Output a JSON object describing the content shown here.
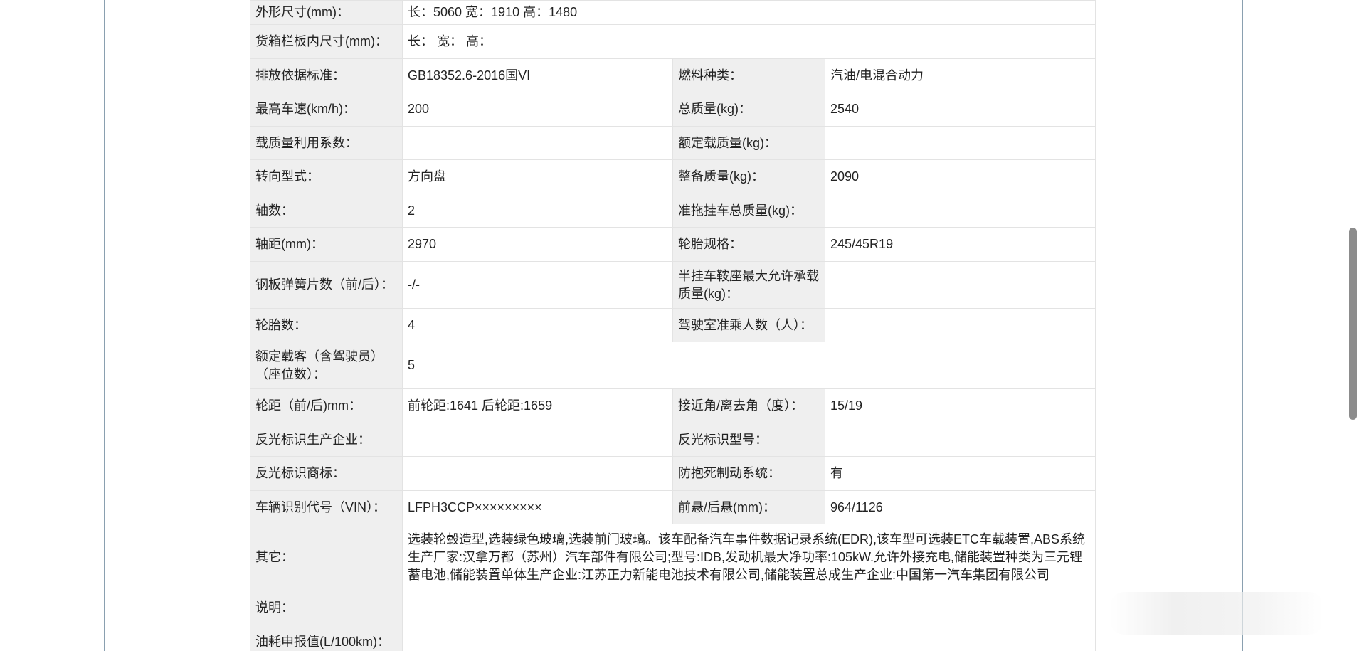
{
  "rows": [
    {
      "label": "外形尺寸(mm)：",
      "value": "长：5060 宽：1910 高：1480"
    },
    {
      "label": "货箱栏板内尺寸(mm)：",
      "value": "长： 宽： 高："
    },
    {
      "label": "排放依据标准：",
      "value": "GB18352.6-2016国VI",
      "label2": "燃料种类：",
      "value2": "汽油/电混合动力"
    },
    {
      "label": "最高车速(km/h)：",
      "value": "200",
      "label2": "总质量(kg)：",
      "value2": "2540"
    },
    {
      "label": "载质量利用系数：",
      "value": "",
      "label2": "额定载质量(kg)：",
      "value2": ""
    },
    {
      "label": "转向型式：",
      "value": "方向盘",
      "label2": "整备质量(kg)：",
      "value2": "2090"
    },
    {
      "label": "轴数：",
      "value": "2",
      "label2": "准拖挂车总质量(kg)：",
      "value2": ""
    },
    {
      "label": "轴距(mm)：",
      "value": "2970",
      "label2": "轮胎规格：",
      "value2": "245/45R19"
    },
    {
      "label": "钢板弹簧片数（前/后）：",
      "value": "-/-",
      "label2": "半挂车鞍座最大允许承载质量(kg)：",
      "value2": ""
    },
    {
      "label": "轮胎数：",
      "value": "4",
      "label2": "驾驶室准乘人数（人）：",
      "value2": ""
    },
    {
      "label": "额定载客（含驾驶员）（座位数）：",
      "value": "5"
    },
    {
      "label": "轮距（前/后)mm：",
      "value": "前轮距:1641 后轮距:1659",
      "label2": "接近角/离去角（度）：",
      "value2": "15/19"
    },
    {
      "label": "反光标识生产企业：",
      "value": "",
      "label2": "反光标识型号：",
      "value2": ""
    },
    {
      "label": "反光标识商标：",
      "value": "",
      "label2": "防抱死制动系统：",
      "value2": "有"
    },
    {
      "label": "车辆识别代号（VIN）：",
      "value": "LFPH3CCP×××××××××",
      "label2": "前悬/后悬(mm)：",
      "value2": "964/1126"
    },
    {
      "label": "其它：",
      "value": "选装轮毂造型,选装绿色玻璃,选装前门玻璃。该车配备汽车事件数据记录系统(EDR),该车型可选装ETC车载装置,ABS系统生产厂家:汉拿万都（苏州）汽车部件有限公司;型号:IDB,发动机最大净功率:105kW.允许外接充电,储能装置种类为三元锂蓄电池,储能装置单体生产企业:江苏正力新能电池技术有限公司,储能装置总成生产企业:中国第一汽车集团有限公司"
    },
    {
      "label": "说明：",
      "value": ""
    },
    {
      "label": "油耗申报值(L/100km)：",
      "value": ""
    }
  ],
  "colors": {
    "label_bg": "#efefef",
    "border": "#e3e3e3",
    "text": "#222222",
    "frame": "#8aa0b0"
  }
}
